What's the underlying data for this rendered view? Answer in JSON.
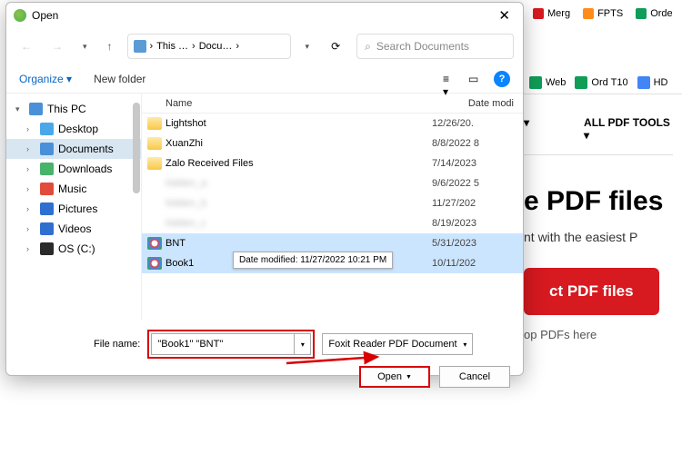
{
  "browser": {
    "tabs": [
      {
        "label": "Merg",
        "color": "#d71920"
      },
      {
        "label": "FPTS",
        "color": "#ff8c1a"
      },
      {
        "label": "Orde",
        "color": "#0f9d58"
      }
    ],
    "bookmarks": [
      {
        "label": "Web",
        "color": "#0f9d58"
      },
      {
        "label": "Ord T10",
        "color": "#0f9d58"
      },
      {
        "label": "HD",
        "color": "#4285f4"
      }
    ],
    "tools_menu": "ALL PDF TOOLS ▾",
    "headline": "e PDF files",
    "subtitle": "nt with the easiest P",
    "cta": "ct PDF files",
    "drop_hint": "op PDFs here"
  },
  "dialog": {
    "title": "Open",
    "breadcrumb": [
      "This …",
      "Docu…"
    ],
    "search_placeholder": "Search Documents",
    "organize": "Organize ▾",
    "new_folder": "New folder",
    "tree": [
      {
        "label": "This PC",
        "chev": "▾",
        "color": "#4a90d9",
        "indent": 0,
        "sel": false
      },
      {
        "label": "Desktop",
        "chev": "›",
        "color": "#4aa8e8",
        "indent": 1,
        "sel": false
      },
      {
        "label": "Documents",
        "chev": "›",
        "color": "#4a90d9",
        "indent": 1,
        "sel": true
      },
      {
        "label": "Downloads",
        "chev": "›",
        "color": "#47b36b",
        "indent": 1,
        "sel": false
      },
      {
        "label": "Music",
        "chev": "›",
        "color": "#e14b3b",
        "indent": 1,
        "sel": false
      },
      {
        "label": "Pictures",
        "chev": "›",
        "color": "#2f6fd0",
        "indent": 1,
        "sel": false
      },
      {
        "label": "Videos",
        "chev": "›",
        "color": "#2f6fd0",
        "indent": 1,
        "sel": false
      },
      {
        "label": "OS (C:)",
        "chev": "›",
        "color": "#2a2a2a",
        "indent": 1,
        "sel": false
      }
    ],
    "cols": {
      "name": "Name",
      "date": "Date modi"
    },
    "rows": [
      {
        "name": "Lightshot",
        "date": "12/26/20.",
        "type": "folder",
        "sel": false,
        "blur": false
      },
      {
        "name": "XuanZhi",
        "date": "8/8/2022 8",
        "type": "folder",
        "sel": false,
        "blur": false
      },
      {
        "name": "Zalo Received Files",
        "date": "7/14/2023",
        "type": "folder",
        "sel": false,
        "blur": false
      },
      {
        "name": "hidden_a",
        "date": "9/6/2022 5",
        "type": "file",
        "sel": false,
        "blur": true
      },
      {
        "name": "hidden_b",
        "date": "11/27/202",
        "type": "file",
        "sel": false,
        "blur": true
      },
      {
        "name": "hidden_c",
        "date": "8/19/2023",
        "type": "file",
        "sel": false,
        "blur": true
      },
      {
        "name": "BNT",
        "date": "5/31/2023",
        "type": "pdf",
        "sel": true,
        "blur": false
      },
      {
        "name": "Book1",
        "date": "10/11/202",
        "type": "pdf",
        "sel": true,
        "blur": false
      }
    ],
    "tooltip": "Date modified: 11/27/2022 10:21 PM",
    "filename_label": "File name:",
    "filename_value": "\"Book1\" \"BNT\"",
    "filetype": "Foxit Reader PDF Document",
    "open": "Open",
    "cancel": "Cancel"
  }
}
